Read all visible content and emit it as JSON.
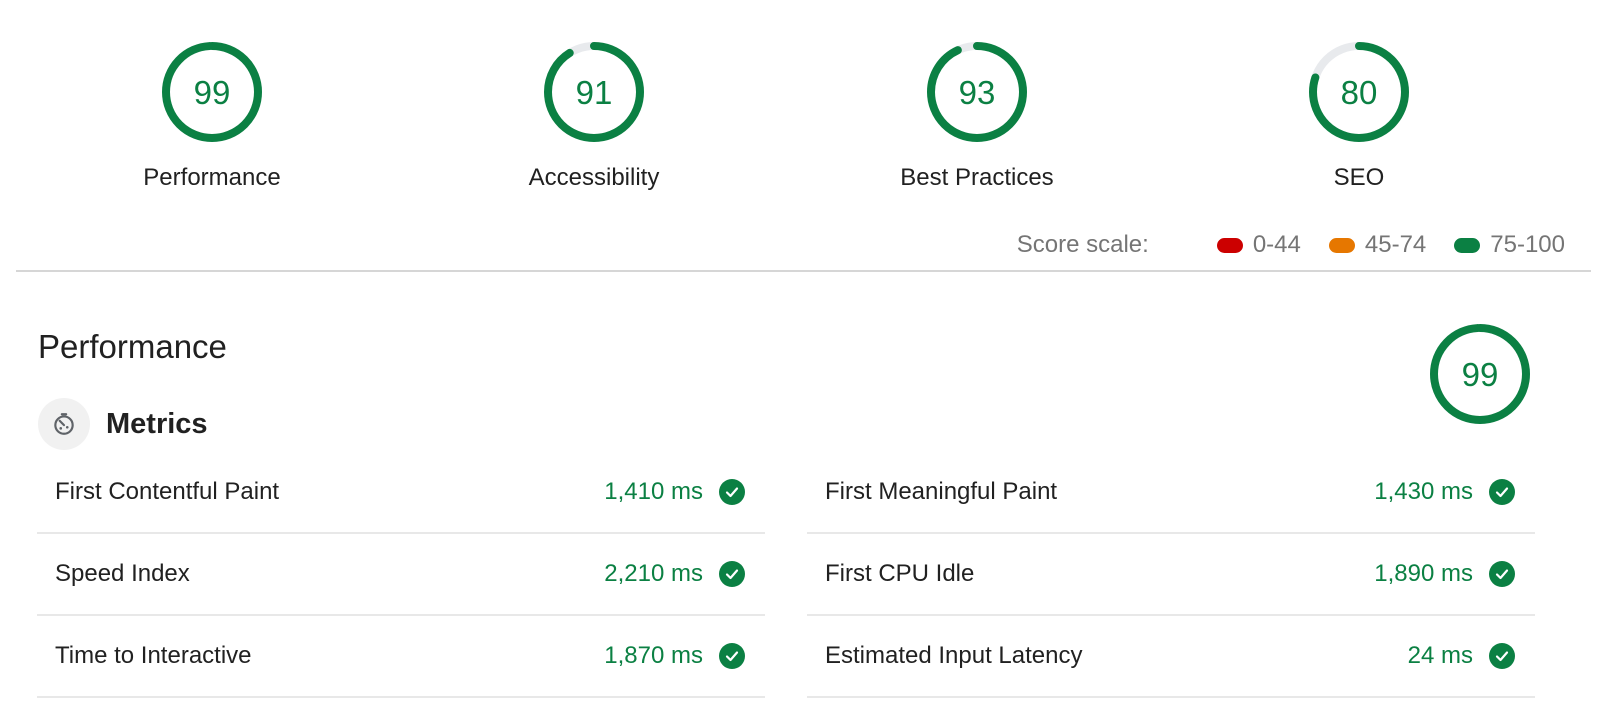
{
  "colors": {
    "pass": "#0b8043",
    "average": "#e67700",
    "fail": "#cc0000",
    "track": "#e8eaed"
  },
  "categories": [
    {
      "label": "Performance",
      "score": 99
    },
    {
      "label": "Accessibility",
      "score": 91
    },
    {
      "label": "Best Practices",
      "score": 93
    },
    {
      "label": "SEO",
      "score": 80
    }
  ],
  "score_scale": {
    "title": "Score scale:",
    "ranges": [
      {
        "label": "0-44",
        "color": "#cc0000"
      },
      {
        "label": "45-74",
        "color": "#e67700"
      },
      {
        "label": "75-100",
        "color": "#0b8043"
      }
    ]
  },
  "performance": {
    "title": "Performance",
    "score": 99,
    "metrics_title": "Metrics",
    "metrics_icon": "stopwatch-icon",
    "metrics_left": [
      {
        "name": "First Contentful Paint",
        "value": "1,410 ms",
        "status": "pass"
      },
      {
        "name": "Speed Index",
        "value": "2,210 ms",
        "status": "pass"
      },
      {
        "name": "Time to Interactive",
        "value": "1,870 ms",
        "status": "pass"
      }
    ],
    "metrics_right": [
      {
        "name": "First Meaningful Paint",
        "value": "1,430 ms",
        "status": "pass"
      },
      {
        "name": "First CPU Idle",
        "value": "1,890 ms",
        "status": "pass"
      },
      {
        "name": "Estimated Input Latency",
        "value": "24 ms",
        "status": "pass"
      }
    ]
  }
}
